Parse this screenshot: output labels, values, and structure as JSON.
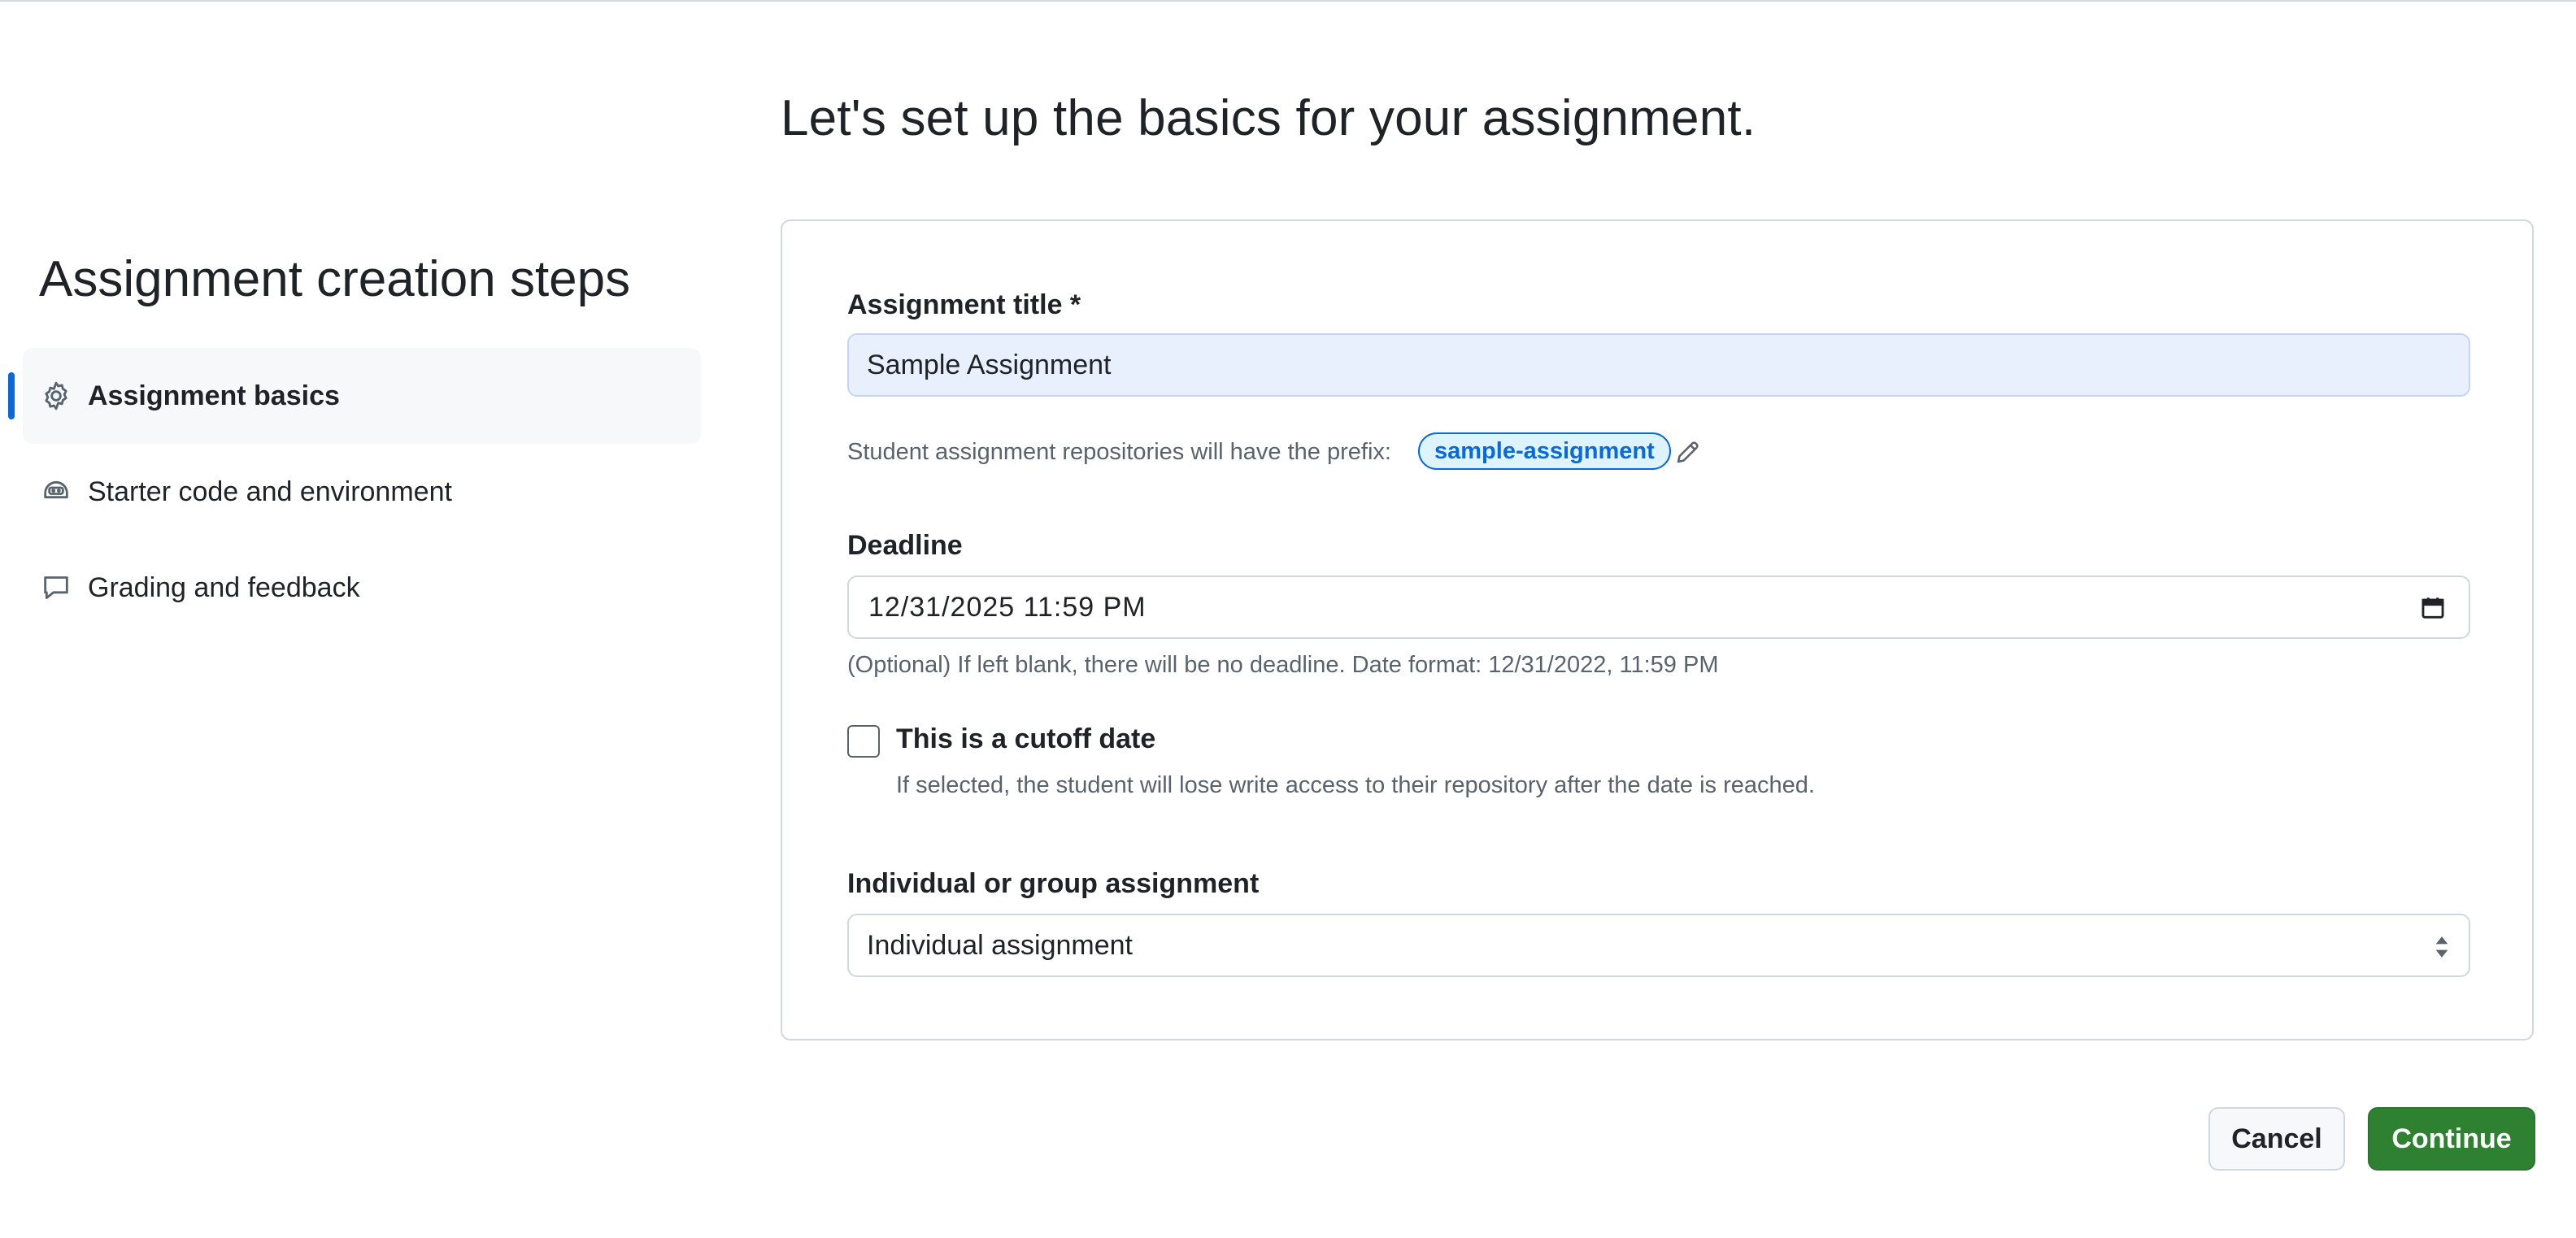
{
  "page": {
    "title": "Let's set up the basics for your assignment."
  },
  "sidebar": {
    "title": "Assignment creation steps",
    "steps": [
      {
        "label": "Assignment basics",
        "icon": "gear-icon",
        "active": true
      },
      {
        "label": "Starter code and environment",
        "icon": "codespaces-icon",
        "active": false
      },
      {
        "label": "Grading and feedback",
        "icon": "comment-icon",
        "active": false
      }
    ]
  },
  "form": {
    "title_label": "Assignment title *",
    "title_value": "Sample Assignment",
    "prefix_hint": "Student assignment repositories will have the prefix:",
    "prefix_value": "sample-assignment",
    "deadline_label": "Deadline",
    "deadline_value": "12/31/2025 11:59 PM",
    "deadline_hint": "(Optional) If left blank, there will be no deadline. Date format: 12/31/2022, 11:59 PM",
    "cutoff_label": "This is a cutoff date",
    "cutoff_checked": false,
    "cutoff_hint": "If selected, the student will lose write access to their repository after the date is reached.",
    "type_label": "Individual or group assignment",
    "type_value": "Individual assignment"
  },
  "actions": {
    "cancel_label": "Cancel",
    "continue_label": "Continue"
  },
  "colors": {
    "accent": "#0969da",
    "primary_button": "#2f8132",
    "filled_input": "#e8f0fe"
  }
}
